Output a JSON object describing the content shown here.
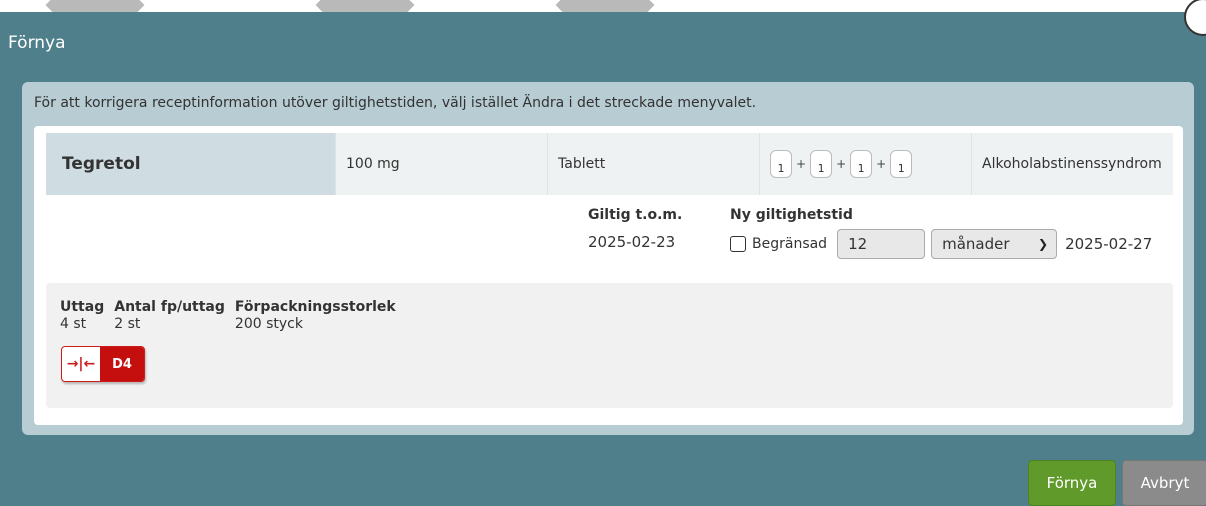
{
  "dialog": {
    "title": "Förnya"
  },
  "info": {
    "text": "För att korrigera receptinformation utöver giltighetstiden, välj istället Ändra i det streckade menyvalet."
  },
  "medication": {
    "name": "Tegretol",
    "strength": "100 mg",
    "form": "Tablett",
    "dosage": [
      "1",
      "1",
      "1",
      "1"
    ],
    "plus": "+",
    "indication": "Alkoholabstinenssyndrom"
  },
  "validity": {
    "current_label": "Giltig t.o.m.",
    "current_value": "2025-02-23",
    "new_label": "Ny giltighetstid",
    "limited_label": "Begränsad",
    "limited_checked": false,
    "months_value": "12",
    "unit_selected": "månader",
    "new_date": "2025-02-27"
  },
  "package": {
    "withdrawal_label": "Uttag",
    "withdrawal_value": "4 st",
    "per_withdrawal_label": "Antal fp/uttag",
    "per_withdrawal_value": "2 st",
    "size_label": "Förpackningsstorlek",
    "size_value": "200 styck",
    "flag_icon": "merge-arrows-icon",
    "flag_code": "D4"
  },
  "actions": {
    "renew_label": "Förnya",
    "cancel_label": "Avbryt"
  },
  "colors": {
    "backdrop": "#4e7f8b",
    "renew": "#5f9a2a",
    "cancel": "#8b8b8b",
    "flag": "#c50f0f"
  }
}
